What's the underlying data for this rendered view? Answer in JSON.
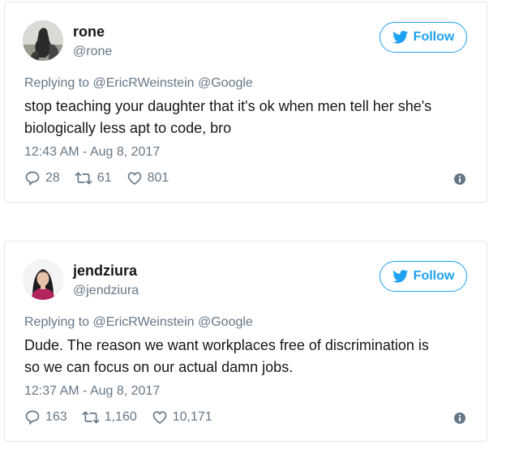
{
  "tweets": [
    {
      "name": "rone",
      "handle": "@rone",
      "follow_label": "Follow",
      "replying_prefix": "Replying to",
      "mentions": [
        "@EricRWeinstein",
        "@Google"
      ],
      "text_line1": "stop teaching your daughter that it's ok when men tell her she's",
      "text_line2": "biologically less apt to code, bro",
      "timestamp": "12:43 AM - Aug 8, 2017",
      "replies": "28",
      "retweets": "61",
      "likes": "801"
    },
    {
      "name": "jendziura",
      "handle": "@jendziura",
      "follow_label": "Follow",
      "replying_prefix": "Replying to",
      "mentions": [
        "@EricRWeinstein",
        "@Google"
      ],
      "text_line1": "Dude. The reason we want workplaces free of discrimination is",
      "text_line2": "so we can focus on our actual damn jobs.",
      "timestamp": "12:37 AM - Aug 8, 2017",
      "replies": "163",
      "retweets": "1,160",
      "likes": "10,171"
    }
  ],
  "colors": {
    "accent": "#1da1f2",
    "secondary_text": "#657786",
    "primary_text": "#14171a",
    "border": "#e1e8ed"
  },
  "icons": {
    "follow": "twitter-bird-icon",
    "reply": "reply-icon",
    "retweet": "retweet-icon",
    "like": "heart-icon",
    "info": "info-icon"
  }
}
